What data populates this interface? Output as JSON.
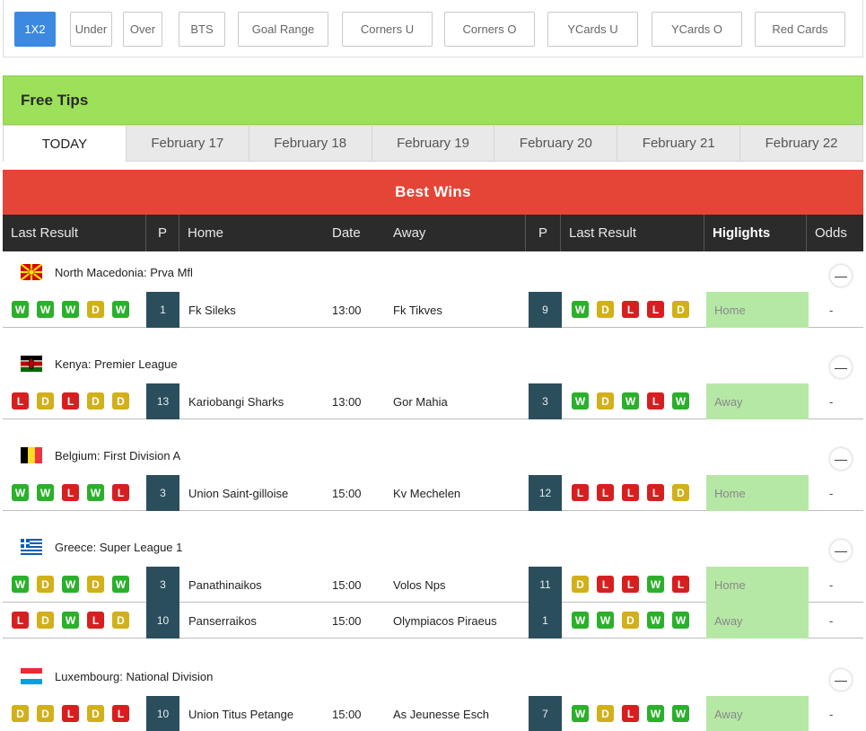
{
  "filters": [
    {
      "label": "1X2",
      "active": true
    },
    {
      "label": "Under"
    },
    {
      "label": "Over"
    },
    {
      "label": "BTS"
    },
    {
      "label": "Goal Range"
    },
    {
      "label": "Corners U"
    },
    {
      "label": "Corners O"
    },
    {
      "label": "YCards U"
    },
    {
      "label": "YCards O"
    },
    {
      "label": "Red Cards"
    }
  ],
  "free_tips_title": "Free Tips",
  "date_tabs": [
    {
      "label": "TODAY",
      "active": true
    },
    {
      "label": "February 17"
    },
    {
      "label": "February 18"
    },
    {
      "label": "February 19"
    },
    {
      "label": "February 20"
    },
    {
      "label": "February 21"
    },
    {
      "label": "February 22"
    }
  ],
  "best_wins_title": "Best Wins",
  "table_headers": {
    "last_result_home": "Last Result",
    "p_home": "P",
    "home": "Home",
    "date": "Date",
    "away": "Away",
    "p_away": "P",
    "last_result_away": "Last Result",
    "highlights": "Higlights",
    "odds": "Odds"
  },
  "collapse_symbol": "—",
  "sections": [
    {
      "league": "North Macedonia: Prva Mfl",
      "flag": "mk",
      "matches": [
        {
          "home_form": [
            "W",
            "W",
            "W",
            "D",
            "W"
          ],
          "home_pos": "1",
          "home": "Fk Sileks",
          "time": "13:00",
          "away": "Fk Tikves",
          "away_pos": "9",
          "away_form": [
            "W",
            "D",
            "L",
            "L",
            "D"
          ],
          "tip": "Home",
          "odds": "-"
        }
      ]
    },
    {
      "league": "Kenya: Premier League",
      "flag": "ke",
      "matches": [
        {
          "home_form": [
            "L",
            "D",
            "L",
            "D",
            "D"
          ],
          "home_pos": "13",
          "home": "Kariobangi Sharks",
          "time": "13:00",
          "away": "Gor Mahia",
          "away_pos": "3",
          "away_form": [
            "W",
            "D",
            "W",
            "L",
            "W"
          ],
          "tip": "Away",
          "odds": "-"
        }
      ]
    },
    {
      "league": "Belgium: First Division A",
      "flag": "be",
      "matches": [
        {
          "home_form": [
            "W",
            "W",
            "L",
            "W",
            "L"
          ],
          "home_pos": "3",
          "home": "Union Saint-gilloise",
          "time": "15:00",
          "away": "Kv Mechelen",
          "away_pos": "12",
          "away_form": [
            "L",
            "L",
            "L",
            "L",
            "D"
          ],
          "tip": "Home",
          "odds": "-"
        }
      ]
    },
    {
      "league": "Greece: Super League 1",
      "flag": "gr",
      "matches": [
        {
          "home_form": [
            "W",
            "D",
            "W",
            "D",
            "W"
          ],
          "home_pos": "3",
          "home": "Panathinaikos",
          "time": "15:00",
          "away": "Volos Nps",
          "away_pos": "11",
          "away_form": [
            "D",
            "L",
            "L",
            "W",
            "L"
          ],
          "tip": "Home",
          "odds": "-"
        },
        {
          "home_form": [
            "L",
            "D",
            "W",
            "L",
            "D"
          ],
          "home_pos": "10",
          "home": "Panserraikos",
          "time": "15:00",
          "away": "Olympiacos Piraeus",
          "away_pos": "1",
          "away_form": [
            "W",
            "W",
            "D",
            "W",
            "W"
          ],
          "tip": "Away",
          "odds": "-"
        }
      ]
    },
    {
      "league": "Luxembourg: National Division",
      "flag": "lu",
      "matches": [
        {
          "home_form": [
            "D",
            "D",
            "L",
            "D",
            "L"
          ],
          "home_pos": "10",
          "home": "Union Titus Petange",
          "time": "15:00",
          "away": "As Jeunesse Esch",
          "away_pos": "7",
          "away_form": [
            "W",
            "D",
            "L",
            "W",
            "W"
          ],
          "tip": "Away",
          "odds": "-"
        }
      ]
    }
  ]
}
